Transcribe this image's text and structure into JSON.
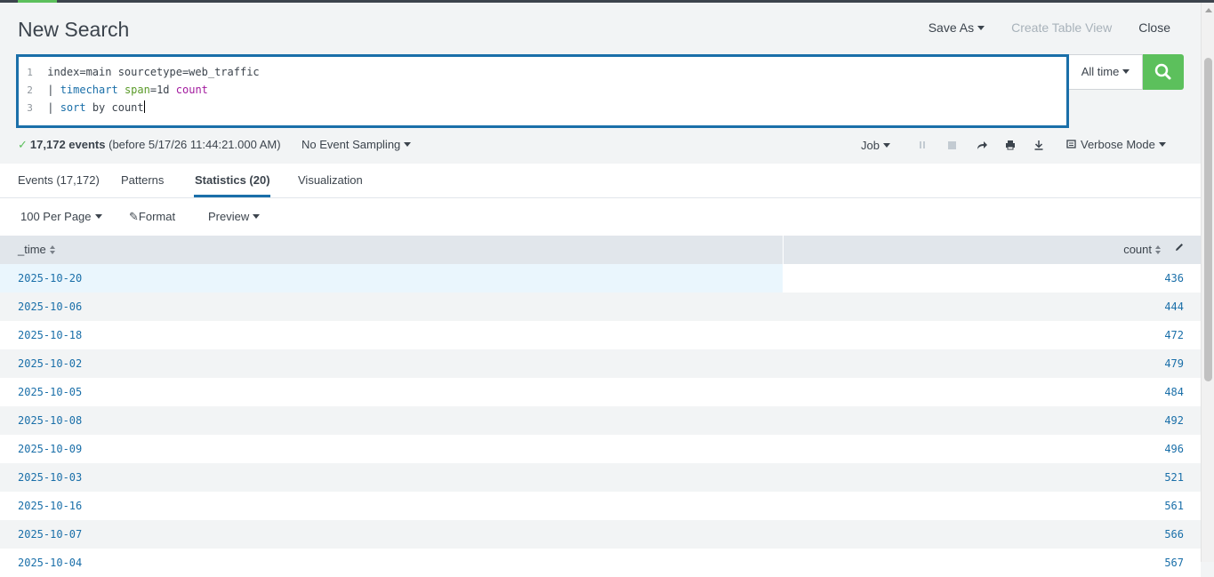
{
  "header": {
    "title": "New Search",
    "save_as": "Save As",
    "create_table_view": "Create Table View",
    "close": "Close"
  },
  "search": {
    "lines": [
      {
        "num": "1",
        "text": "index=main sourcetype=web_traffic"
      },
      {
        "num": "2",
        "pipe": "| ",
        "cmd": "timechart",
        "sp": " ",
        "arg": "span",
        "eq": "=1d ",
        "fn": "count"
      },
      {
        "num": "3",
        "pipe": "| ",
        "cmd": "sort",
        "rest": " by count"
      }
    ],
    "time_range": "All time"
  },
  "status": {
    "count": "17,172 events",
    "detail": "(before 5/17/26 11:44:21.000 AM)",
    "sampling": "No Event Sampling",
    "job": "Job",
    "mode": "Verbose Mode"
  },
  "tabs": [
    {
      "label": "Events (17,172)"
    },
    {
      "label": "Patterns"
    },
    {
      "label": "Statistics (20)"
    },
    {
      "label": "Visualization"
    }
  ],
  "options": {
    "per_page": "100 Per Page",
    "format": "Format",
    "preview": "Preview"
  },
  "table": {
    "columns": [
      "_time",
      "count"
    ],
    "rows": [
      {
        "time": "2025-10-20",
        "count": "436"
      },
      {
        "time": "2025-10-06",
        "count": "444"
      },
      {
        "time": "2025-10-18",
        "count": "472"
      },
      {
        "time": "2025-10-02",
        "count": "479"
      },
      {
        "time": "2025-10-05",
        "count": "484"
      },
      {
        "time": "2025-10-08",
        "count": "492"
      },
      {
        "time": "2025-10-09",
        "count": "496"
      },
      {
        "time": "2025-10-03",
        "count": "521"
      },
      {
        "time": "2025-10-16",
        "count": "561"
      },
      {
        "time": "2025-10-07",
        "count": "566"
      },
      {
        "time": "2025-10-04",
        "count": "567"
      }
    ]
  },
  "colors": {
    "accent_green": "#5cc05c",
    "link_blue": "#1a6fa9",
    "text": "#3c444d"
  }
}
